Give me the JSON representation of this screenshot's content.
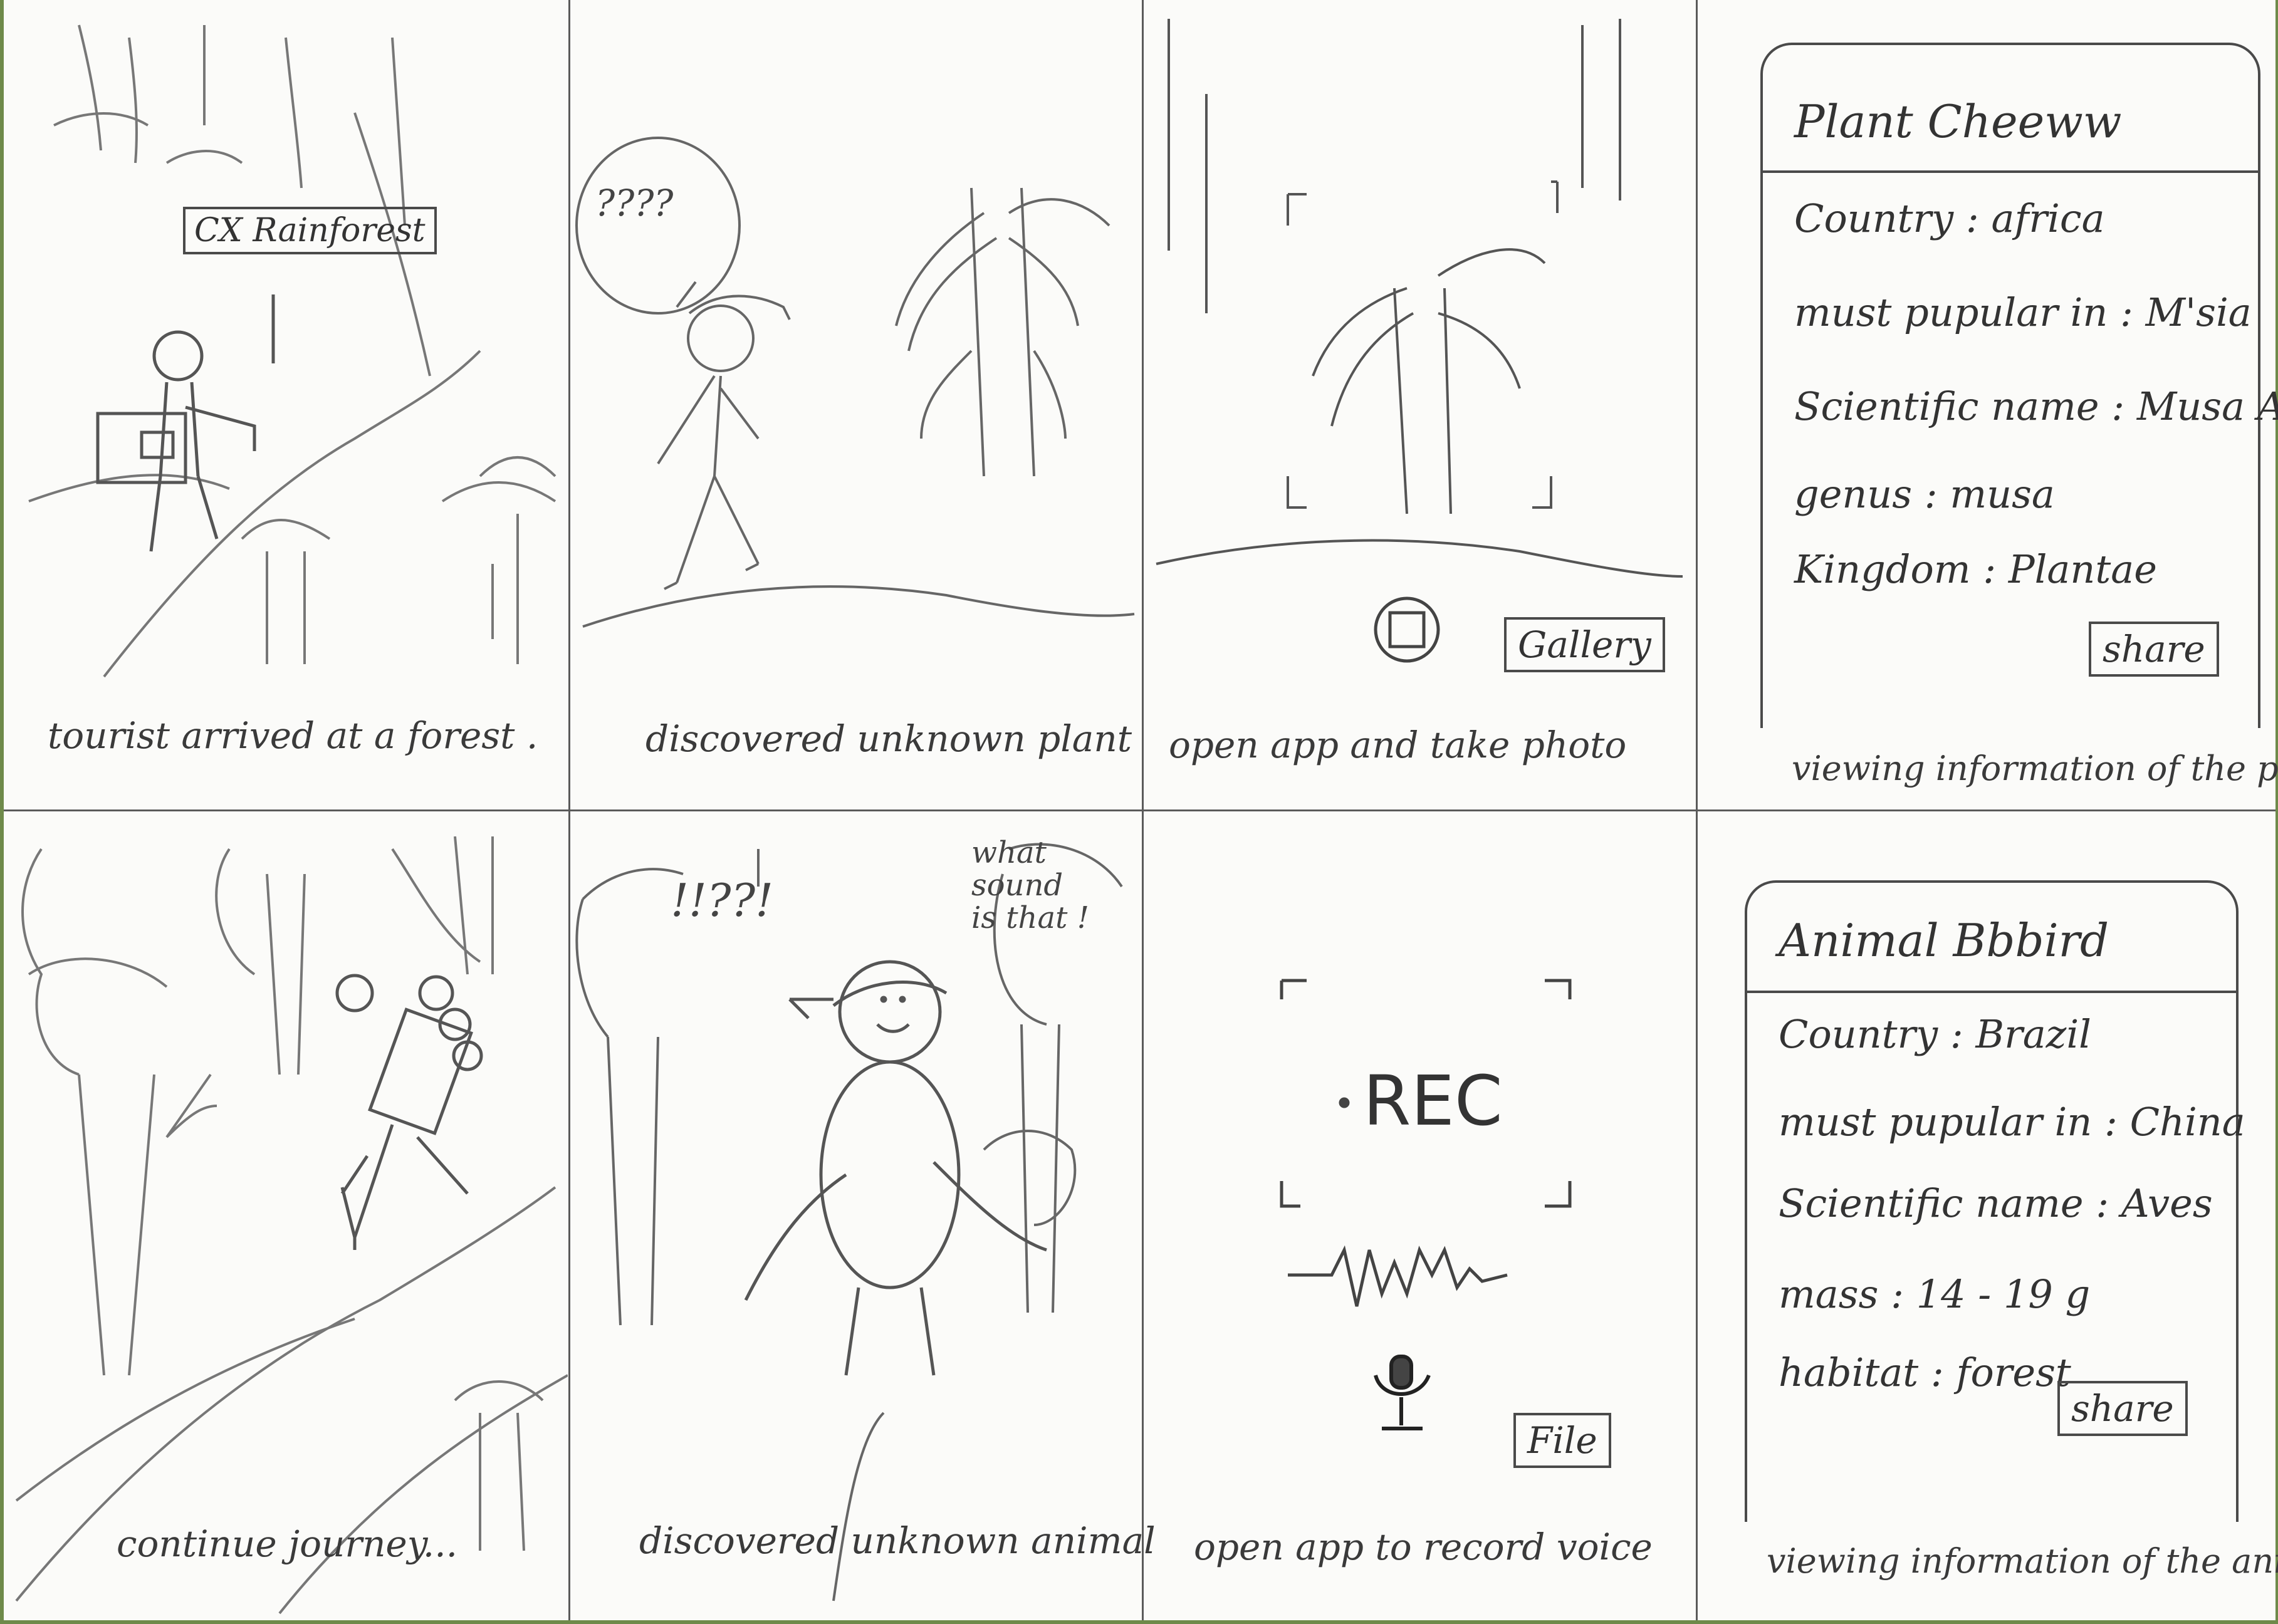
{
  "panels": [
    {
      "caption": "tourist arrived at a forest .",
      "sign": "CX Rainforest"
    },
    {
      "caption": "discovered unknown plant",
      "bubble": "????"
    },
    {
      "caption": "open app and take photo",
      "gallery_button": "Gallery"
    },
    {
      "caption": "viewing information of the plant",
      "title": "Plant Cheeww",
      "lines": [
        "Country : africa",
        "must pupular in : M'sia",
        "Scientific name : Musa Acc.",
        "genus : musa",
        "Kingdom : Plantae"
      ],
      "share_button": "share"
    },
    {
      "caption": "continue journey..."
    },
    {
      "caption": "discovered unknown animal",
      "bubble_marks": "!!??!",
      "bubble": "what sound is that !"
    },
    {
      "caption": "open app to record voice",
      "rec_label": "REC",
      "file_button": "File"
    },
    {
      "caption": "viewing information of the animal",
      "title": "Animal Bbbird",
      "lines": [
        "Country : Brazil",
        "must pupular in : China",
        "Scientific name : Aves",
        "mass : 14 - 19 g",
        "habitat : forest"
      ],
      "share_button": "share"
    }
  ]
}
